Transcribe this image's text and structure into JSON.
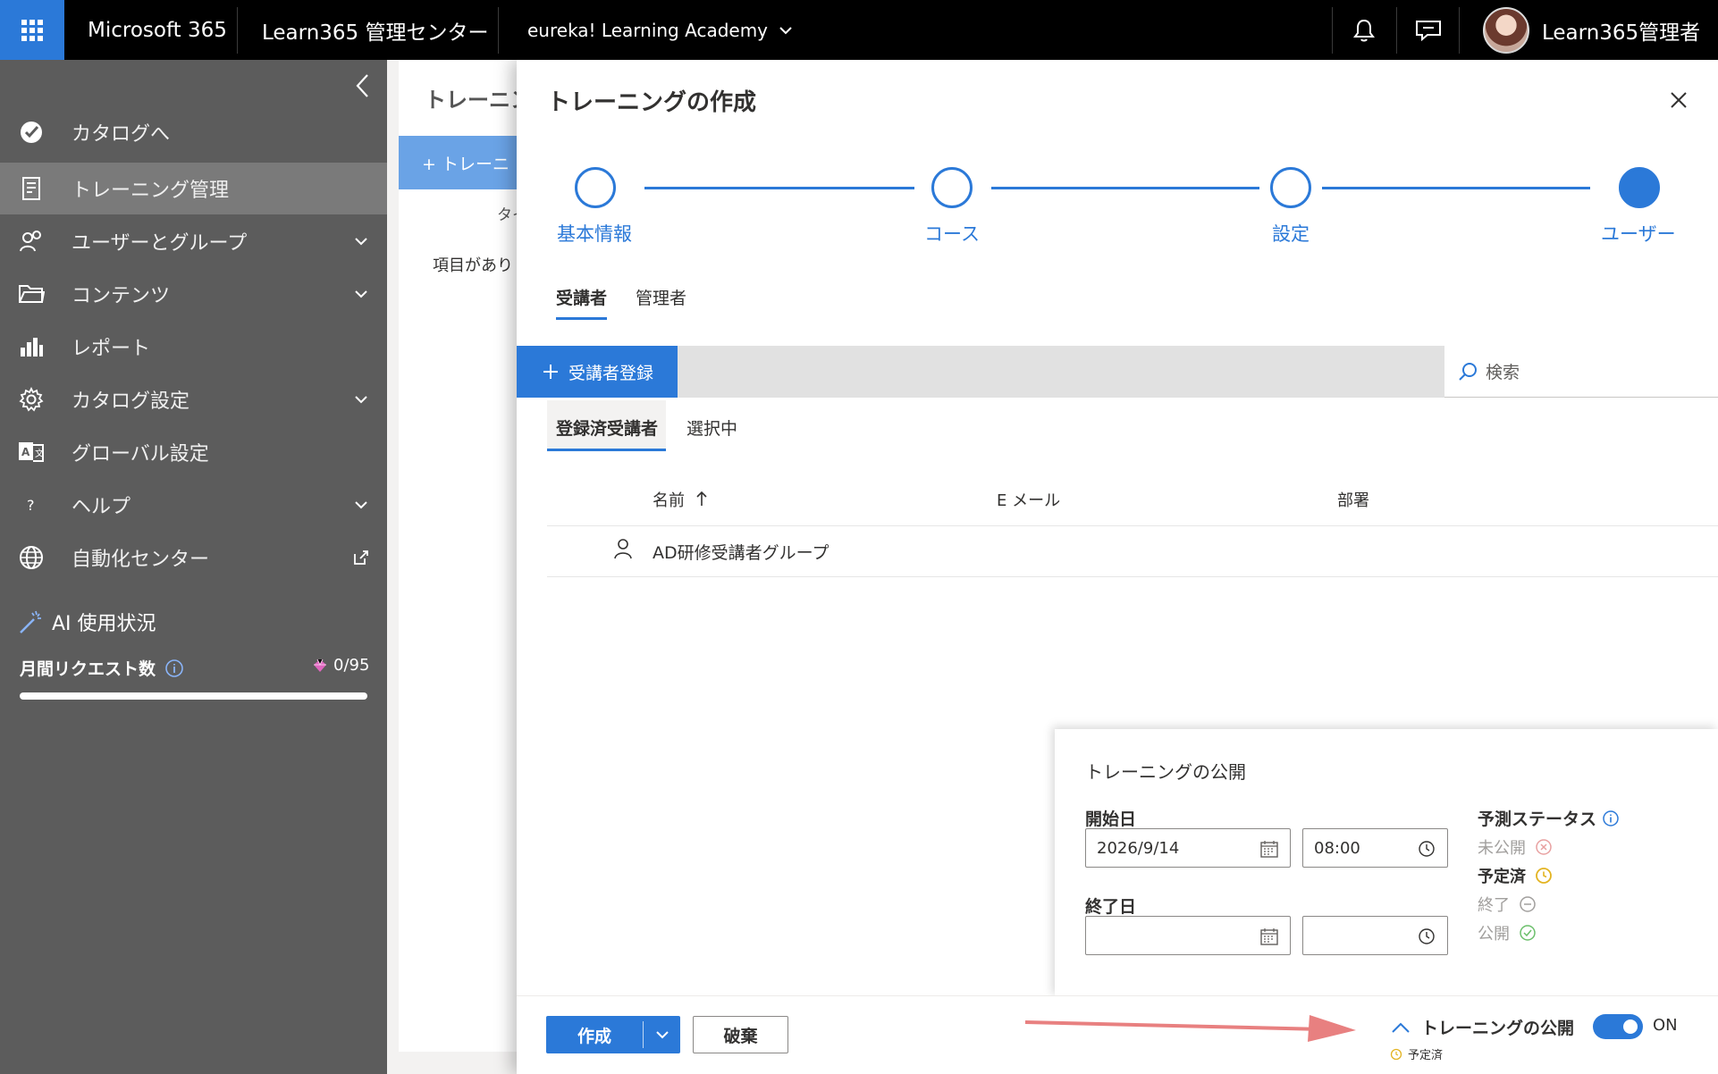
{
  "topbar": {
    "brand": "Microsoft 365",
    "admin_center": "Learn365 管理センター",
    "tenant": "eureka! Learning Academy",
    "user_name": "Learn365管理者"
  },
  "sidebar": {
    "items": [
      {
        "label": "カタログへ"
      },
      {
        "label": "トレーニング管理"
      },
      {
        "label": "ユーザーとグループ"
      },
      {
        "label": "コンテンツ"
      },
      {
        "label": "レポート"
      },
      {
        "label": "カタログ設定"
      },
      {
        "label": "グローバル設定"
      },
      {
        "label": "ヘルプ"
      },
      {
        "label": "自動化センター"
      }
    ],
    "ai": {
      "title": "AI 使用状況",
      "monthly_label": "月間リクエスト数",
      "count": "0/95",
      "usage_fraction": 0.0
    }
  },
  "background": {
    "title_fragment": "トレーニン",
    "button_fragment": "+ トレーニ",
    "col_fragment": "タイ",
    "empty_fragment": "項目があり"
  },
  "panel": {
    "title": "トレーニングの作成",
    "steps": [
      {
        "label": "基本情報",
        "done": false
      },
      {
        "label": "コース",
        "done": false
      },
      {
        "label": "設定",
        "done": false
      },
      {
        "label": "ユーザー",
        "done": true
      }
    ],
    "tabs": [
      "受講者",
      "管理者"
    ],
    "add_button": "受講者登録",
    "search_placeholder": "検索",
    "subtabs": [
      "登録済受講者",
      "選択中"
    ],
    "columns": [
      "名前",
      "E メール",
      "部署"
    ],
    "rows": [
      {
        "name": "AD研修受講者グループ",
        "email": "",
        "dept": ""
      }
    ]
  },
  "publish": {
    "title": "トレーニングの公開",
    "start_label": "開始日",
    "start_date": "2026/9/14",
    "start_time": "08:00",
    "end_label": "終了日",
    "end_date": "",
    "end_time": "",
    "status_title": "予測ステータス",
    "statuses": [
      {
        "label": "未公開",
        "color": "#e8a0a0",
        "active": false
      },
      {
        "label": "予定済",
        "color": "#e3b422",
        "active": true
      },
      {
        "label": "終了",
        "color": "#a19f9d",
        "active": false
      },
      {
        "label": "公開",
        "color": "#6bbf6b",
        "active": false
      }
    ]
  },
  "footer": {
    "create_label": "作成",
    "discard_label": "破棄",
    "publish_toggle_label": "トレーニングの公開",
    "publish_status": "予定済",
    "toggle_state": "ON"
  },
  "colors": {
    "accent": "#2b79d8",
    "annotation_arrow": "#e88080"
  }
}
